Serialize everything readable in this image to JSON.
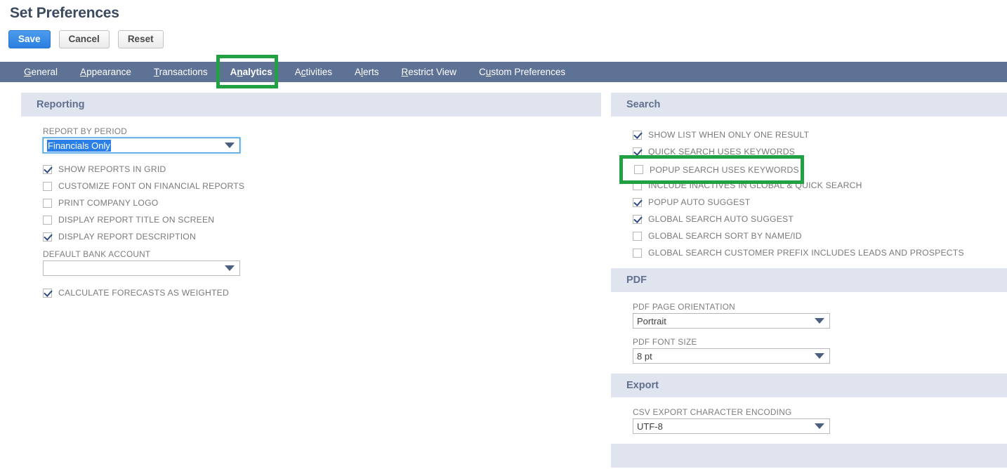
{
  "header": {
    "title": "Set Preferences",
    "buttons": [
      {
        "label": "Save",
        "style": "primary"
      },
      {
        "label": "Cancel",
        "style": "secondary"
      },
      {
        "label": "Reset",
        "style": "secondary"
      }
    ]
  },
  "tabs": [
    {
      "label": "General",
      "accel": "G",
      "active": false
    },
    {
      "label": "Appearance",
      "accel": "A",
      "active": false
    },
    {
      "label": "Transactions",
      "accel": "T",
      "active": false
    },
    {
      "label": "Analytics",
      "accel": "n",
      "active": true
    },
    {
      "label": "Activities",
      "accel": "c",
      "active": false
    },
    {
      "label": "Alerts",
      "accel": "l",
      "active": false
    },
    {
      "label": "Restrict View",
      "accel": "R",
      "active": false
    },
    {
      "label": "Custom Preferences",
      "accel": "u",
      "active": false
    }
  ],
  "left_panel": {
    "section_title": "Reporting",
    "report_by_period": {
      "label": "REPORT BY PERIOD",
      "value": "Financials Only",
      "focused": true
    },
    "checkboxes_top": [
      {
        "label": "SHOW REPORTS IN GRID",
        "checked": true
      },
      {
        "label": "CUSTOMIZE FONT ON FINANCIAL REPORTS",
        "checked": false
      },
      {
        "label": "PRINT COMPANY LOGO",
        "checked": false
      },
      {
        "label": "DISPLAY REPORT TITLE ON SCREEN",
        "checked": false
      },
      {
        "label": "DISPLAY REPORT DESCRIPTION",
        "checked": true
      }
    ],
    "default_bank_account": {
      "label": "DEFAULT BANK ACCOUNT",
      "value": ""
    },
    "checkboxes_bottom": [
      {
        "label": "CALCULATE FORECASTS AS WEIGHTED",
        "checked": true
      }
    ]
  },
  "right_panel": {
    "search": {
      "section_title": "Search",
      "checkboxes": [
        {
          "label": "SHOW LIST WHEN ONLY ONE RESULT",
          "checked": true
        },
        {
          "label": "QUICK SEARCH USES KEYWORDS",
          "checked": true
        },
        {
          "label": "POPUP SEARCH USES KEYWORDS",
          "checked": false
        },
        {
          "label": "INCLUDE INACTIVES IN GLOBAL & QUICK SEARCH",
          "checked": false
        },
        {
          "label": "POPUP AUTO SUGGEST",
          "checked": true
        },
        {
          "label": "GLOBAL SEARCH AUTO SUGGEST",
          "checked": true
        },
        {
          "label": "GLOBAL SEARCH SORT BY NAME/ID",
          "checked": false
        },
        {
          "label": "GLOBAL SEARCH CUSTOMER PREFIX INCLUDES LEADS AND PROSPECTS",
          "checked": false
        }
      ]
    },
    "pdf": {
      "section_title": "PDF",
      "page_orientation": {
        "label": "PDF PAGE ORIENTATION",
        "value": "Portrait"
      },
      "font_size": {
        "label": "PDF FONT SIZE",
        "value": "8 pt"
      }
    },
    "export": {
      "section_title": "Export",
      "csv_encoding": {
        "label": "CSV EXPORT CHARACTER ENCODING",
        "value": "UTF-8"
      }
    }
  },
  "annotations": {
    "tab_highlight_color": "#21a144",
    "popup_highlight_color": "#21a144",
    "popup_overlay_label": "POPUP SEARCH USES KEYWORDS"
  },
  "colors": {
    "tabbar": "#5e7296",
    "section_header": "#dfe4ee",
    "primary_button": "#2b7fe0",
    "annotation_green": "#21a144",
    "title_text": "#3b4a5f"
  }
}
